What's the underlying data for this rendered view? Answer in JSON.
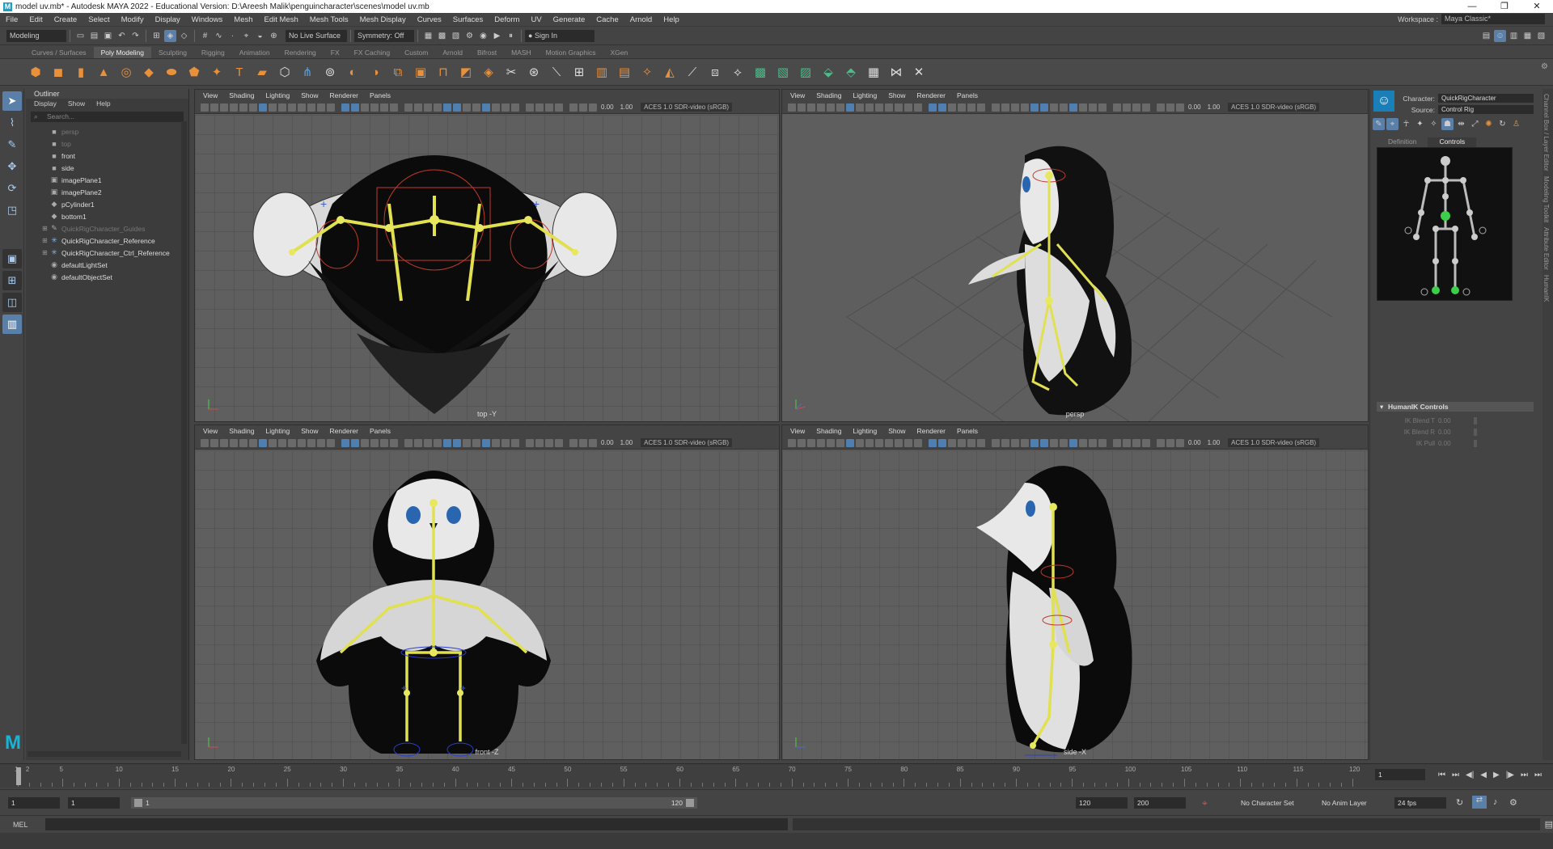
{
  "app": {
    "title": "model uv.mb* - Autodesk MAYA 2022 - Educational Version: D:\\Areesh Malik\\penguincharacter\\scenes\\model uv.mb",
    "menus": [
      "File",
      "Edit",
      "Create",
      "Select",
      "Modify",
      "Display",
      "Windows",
      "Mesh",
      "Edit Mesh",
      "Mesh Tools",
      "Mesh Display",
      "Curves",
      "Surfaces",
      "Deform",
      "UV",
      "Generate",
      "Cache",
      "Arnold",
      "Help"
    ],
    "workspace_label": "Workspace :",
    "workspace_value": "Maya Classic*"
  },
  "statusline": {
    "mode": "Modeling",
    "live_surface": "No Live Surface",
    "symmetry": "Symmetry: Off",
    "sign_in": "Sign In"
  },
  "shelf": {
    "tabs": [
      "Curves / Surfaces",
      "Poly Modeling",
      "Sculpting",
      "Rigging",
      "Animation",
      "Rendering",
      "FX",
      "FX Caching",
      "Custom",
      "Arnold",
      "Bifrost",
      "MASH",
      "Motion Graphics",
      "XGen"
    ],
    "active_tab": "Poly Modeling"
  },
  "outliner": {
    "title": "Outliner",
    "menu": [
      "Display",
      "Show",
      "Help"
    ],
    "search_placeholder": "Search...",
    "items": [
      {
        "label": "persp",
        "dim": true,
        "icon": "camera-icon"
      },
      {
        "label": "top",
        "dim": true,
        "icon": "camera-icon"
      },
      {
        "label": "front",
        "dim": false,
        "icon": "camera-icon"
      },
      {
        "label": "side",
        "dim": false,
        "icon": "camera-icon"
      },
      {
        "label": "imagePlane1",
        "dim": false,
        "icon": "image-plane-icon"
      },
      {
        "label": "imagePlane2",
        "dim": false,
        "icon": "image-plane-icon"
      },
      {
        "label": "pCylinder1",
        "dim": false,
        "icon": "mesh-icon"
      },
      {
        "label": "bottom1",
        "dim": false,
        "icon": "mesh-icon"
      },
      {
        "label": "QuickRigCharacter_Guides",
        "dim": true,
        "icon": "guides-icon",
        "expand": true
      },
      {
        "label": "QuickRigCharacter_Reference",
        "dim": false,
        "icon": "joint-icon",
        "expand": true
      },
      {
        "label": "QuickRigCharacter_Ctrl_Reference",
        "dim": false,
        "icon": "joint-icon",
        "expand": true
      },
      {
        "label": "defaultLightSet",
        "dim": false,
        "icon": "set-icon"
      },
      {
        "label": "defaultObjectSet",
        "dim": false,
        "icon": "set-icon"
      }
    ]
  },
  "viewport_menu": [
    "View",
    "Shading",
    "Lighting",
    "Show",
    "Renderer",
    "Panels"
  ],
  "viewport_toolbar": {
    "exposure": "0.00",
    "gamma": "1.00",
    "colorspace": "ACES 1.0 SDR-video (sRGB)"
  },
  "viewports": [
    {
      "id": "top",
      "label": "top -Y"
    },
    {
      "id": "persp",
      "label": "persp"
    },
    {
      "id": "front",
      "label": "front -Z"
    },
    {
      "id": "side",
      "label": "side -X"
    }
  ],
  "humanik": {
    "character_label": "Character:",
    "character_value": "QuickRigCharacter",
    "source_label": "Source:",
    "source_value": "Control Rig",
    "tabs": [
      "Definition",
      "Controls"
    ],
    "active_tab": "Controls",
    "section": "HumanIK Controls",
    "sliders": [
      {
        "name": "IK Blend T",
        "value": "0.00"
      },
      {
        "name": "IK Blend R",
        "value": "0.00"
      },
      {
        "name": "IK Pull",
        "value": "0.00"
      }
    ]
  },
  "side_tabs": [
    "Channel Box / Layer Editor",
    "Modeling Toolkit",
    "Attribute Editor",
    "HumanIK"
  ],
  "timeslider": {
    "ticks": [
      "1",
      "2",
      "5",
      "10",
      "15",
      "20",
      "25",
      "30",
      "35",
      "40",
      "45",
      "50",
      "55",
      "60",
      "65",
      "70",
      "75",
      "80",
      "85",
      "90",
      "95",
      "100",
      "105",
      "110",
      "115",
      "120"
    ],
    "current_frame": "1"
  },
  "range": {
    "start": "1",
    "start_inner": "1",
    "bar_start": "1",
    "bar_end": "120",
    "end_inner": "120",
    "end": "200",
    "char_set": "No Character Set",
    "anim_layer": "No Anim Layer",
    "fps": "24 fps"
  },
  "cmdline": {
    "lang": "MEL"
  }
}
